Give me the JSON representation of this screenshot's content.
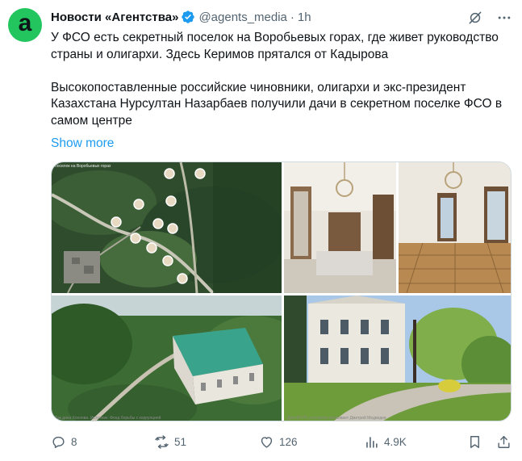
{
  "author": {
    "name": "Новости «Агентства»",
    "handle": "@agents_media",
    "time": "1h",
    "avatar_letter": "a",
    "avatar_color": "#22c55e"
  },
  "tweet": {
    "text": "У ФСО есть секретный поселок на Воробьевых горах, где живет руководство страны и олигархи. Здесь Керимов прятался от Кадырова\n\nВысокопоставленные российские чиновники, олигархи и экс-президент Казахстана Нурсултан Назарбаев получили дачи в секретном поселке ФСО в самом центре",
    "show_more": "Show more"
  },
  "media": {
    "map_title": "поселок на Воробьевых горах",
    "caption_left": "Так дача Хохлова. Источник: Фонд борьбы с коррупцией",
    "caption_right": "Дом ФГУП, в котором проживает Дмитрий Медведев"
  },
  "actions": {
    "replies": "8",
    "reposts": "51",
    "likes": "126",
    "views": "4.9K"
  },
  "colors": {
    "link": "#1d9bf0",
    "muted": "#536471",
    "verified": "#1d9bf0"
  }
}
